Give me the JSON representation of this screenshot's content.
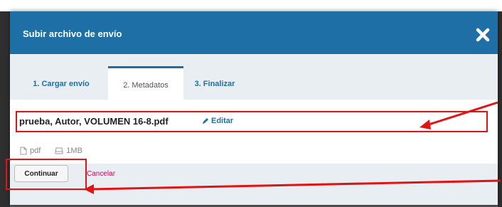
{
  "modal": {
    "title": "Subir archivo de envío",
    "close_icon": "close-icon"
  },
  "tabs": [
    {
      "label": "1. Cargar envío",
      "active": false
    },
    {
      "label": "2. Metadatos",
      "active": true
    },
    {
      "label": "3. Finalizar",
      "active": false
    }
  ],
  "file": {
    "name": "prueba, Autor, VOLUMEN 16-8.pdf",
    "edit_label": "Editar",
    "type": "pdf",
    "size": "1MB"
  },
  "footer": {
    "continue_label": "Continuar",
    "cancel_label": "Cancelar"
  },
  "colors": {
    "header": "#1e6fa6",
    "annotation": "#e01414",
    "cancel": "#d0005e"
  }
}
